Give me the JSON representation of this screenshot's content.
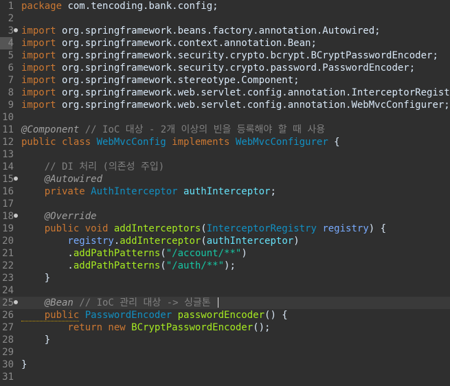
{
  "editor": {
    "lines": [
      {
        "n": "1",
        "tokens": [
          [
            "k",
            "package"
          ],
          [
            "p",
            " com.tencoding.bank.config;"
          ]
        ]
      },
      {
        "n": "2",
        "tokens": []
      },
      {
        "n": "3",
        "fold": true,
        "tokens": [
          [
            "k",
            "import"
          ],
          [
            "p",
            " org.springframework.beans.factory.annotation.Autowired;"
          ]
        ]
      },
      {
        "n": "4",
        "bookmark": true,
        "tokens": [
          [
            "k",
            "import"
          ],
          [
            "p",
            " org.springframework.context.annotation.Bean;"
          ]
        ]
      },
      {
        "n": "5",
        "tokens": [
          [
            "k",
            "import"
          ],
          [
            "p",
            " org.springframework.security.crypto.bcrypt.BCryptPasswordEncoder;"
          ]
        ]
      },
      {
        "n": "6",
        "tokens": [
          [
            "k",
            "import"
          ],
          [
            "p",
            " org.springframework.security.crypto.password.PasswordEncoder;"
          ]
        ]
      },
      {
        "n": "7",
        "tokens": [
          [
            "k",
            "import"
          ],
          [
            "p",
            " org.springframework.stereotype.Component;"
          ]
        ]
      },
      {
        "n": "8",
        "tokens": [
          [
            "k",
            "import"
          ],
          [
            "p",
            " org.springframework.web.servlet.config.annotation.InterceptorRegistry;"
          ]
        ]
      },
      {
        "n": "9",
        "tokens": [
          [
            "k",
            "import"
          ],
          [
            "p",
            " org.springframework.web.servlet.config.annotation.WebMvcConfigurer;"
          ]
        ]
      },
      {
        "n": "10",
        "tokens": []
      },
      {
        "n": "11",
        "tokens": [
          [
            "a",
            "@Component"
          ],
          [
            "c",
            " // IoC 대상 - 2개 이상의 빈을 등록해야 할 때 사용"
          ]
        ]
      },
      {
        "n": "12",
        "tokens": [
          [
            "k",
            "public class "
          ],
          [
            "t",
            "WebMvcConfig"
          ],
          [
            "k",
            " implements "
          ],
          [
            "t",
            "WebMvcConfigurer"
          ],
          [
            "p",
            " {"
          ]
        ]
      },
      {
        "n": "13",
        "tokens": []
      },
      {
        "n": "14",
        "tokens": [
          [
            "c",
            "    // DI 처리 (의존성 주입)"
          ]
        ]
      },
      {
        "n": "15",
        "fold": true,
        "tokens": [
          [
            "a",
            "    @Autowired"
          ]
        ]
      },
      {
        "n": "16",
        "tokens": [
          [
            "k",
            "    private "
          ],
          [
            "t",
            "AuthInterceptor"
          ],
          [
            "f",
            " authInterceptor"
          ],
          [
            "p",
            ";"
          ]
        ]
      },
      {
        "n": "17",
        "tokens": []
      },
      {
        "n": "18",
        "fold": true,
        "tokens": [
          [
            "a",
            "    @Override"
          ]
        ]
      },
      {
        "n": "19",
        "tokens": [
          [
            "k",
            "    public void "
          ],
          [
            "m",
            "addInterceptors"
          ],
          [
            "p",
            "("
          ],
          [
            "t",
            "InterceptorRegistry"
          ],
          [
            "v",
            " registry"
          ],
          [
            "p",
            ") {"
          ]
        ]
      },
      {
        "n": "20",
        "tokens": [
          [
            "v",
            "        registry"
          ],
          [
            "p",
            "."
          ],
          [
            "m",
            "addInterceptor"
          ],
          [
            "p",
            "("
          ],
          [
            "f",
            "authInterceptor"
          ],
          [
            "p",
            ")"
          ]
        ]
      },
      {
        "n": "21",
        "tokens": [
          [
            "p",
            "        ."
          ],
          [
            "m",
            "addPathPatterns"
          ],
          [
            "p",
            "("
          ],
          [
            "s",
            "\"/account/**\""
          ],
          [
            "p",
            ")"
          ]
        ]
      },
      {
        "n": "22",
        "tokens": [
          [
            "p",
            "        ."
          ],
          [
            "m",
            "addPathPatterns"
          ],
          [
            "p",
            "("
          ],
          [
            "s",
            "\"/auth/**\""
          ],
          [
            "p",
            ");"
          ]
        ]
      },
      {
        "n": "23",
        "tokens": [
          [
            "p",
            "    }"
          ]
        ]
      },
      {
        "n": "24",
        "tokens": []
      },
      {
        "n": "25",
        "fold": true,
        "current": true,
        "caret": true,
        "tokens": [
          [
            "a",
            "    @Bean"
          ],
          [
            "c",
            " // IoC 관리 대상 -> 싱글톤 "
          ]
        ]
      },
      {
        "n": "26",
        "tokens": [
          [
            "k",
            "    public"
          ],
          [
            "t",
            " PasswordEncoder"
          ],
          [
            "m",
            " passwordEncoder"
          ],
          [
            "p",
            "() {"
          ]
        ]
      },
      {
        "n": "27",
        "tokens": [
          [
            "k",
            "        return new "
          ],
          [
            "m",
            "BCryptPasswordEncoder"
          ],
          [
            "p",
            "();"
          ]
        ]
      },
      {
        "n": "28",
        "tokens": [
          [
            "p",
            "    }"
          ]
        ]
      },
      {
        "n": "29",
        "tokens": []
      },
      {
        "n": "30",
        "tokens": [
          [
            "p",
            "}"
          ]
        ]
      },
      {
        "n": "31",
        "tokens": []
      }
    ]
  }
}
